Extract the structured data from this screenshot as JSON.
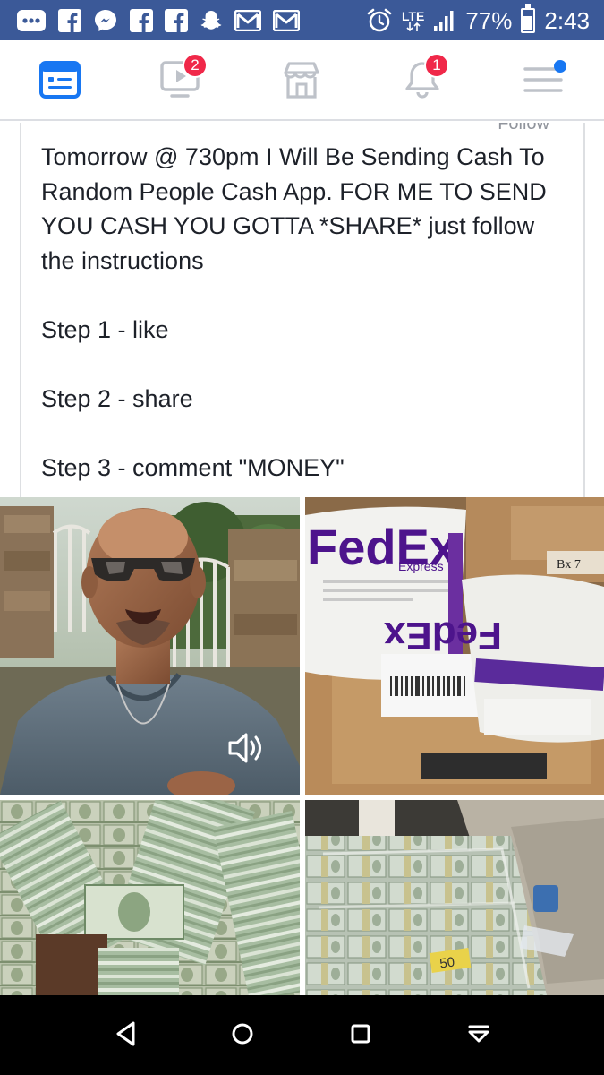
{
  "status_bar": {
    "battery_percent": "77%",
    "battery_level": 0.77,
    "network": "LTE",
    "time": "2:43",
    "background": "#3b5998",
    "left_icons": [
      "overflow-dots-icon",
      "facebook-icon",
      "messenger-icon",
      "facebook-icon",
      "facebook-icon",
      "snapchat-icon",
      "gmail-icon",
      "gmail-icon"
    ],
    "right_icons": [
      "alarm-icon",
      "lte-icon",
      "signal-icon",
      "battery-icon"
    ]
  },
  "fb_nav": {
    "items": [
      {
        "name": "news-feed",
        "icon": "news-feed-icon",
        "active": true
      },
      {
        "name": "watch",
        "icon": "video-icon",
        "badge": "2"
      },
      {
        "name": "marketplace",
        "icon": "marketplace-icon"
      },
      {
        "name": "notifications",
        "icon": "bell-icon",
        "badge": "1"
      },
      {
        "name": "menu",
        "icon": "menu-icon",
        "dot": true
      }
    ],
    "active_color": "#1877f2",
    "inactive_color": "#bec2c9",
    "badge_color": "#f02849"
  },
  "post": {
    "follow_peek": "Follow",
    "paragraphs": [
      "Tomorrow @ 730pm I Will Be Sending Cash To Random People Cash App. FOR ME TO SEND YOU CASH YOU GOTTA *SHARE* just follow the instructions",
      "Step 1 - like",
      "Step 2 - share",
      "Step 3 - comment \"MONEY\""
    ]
  },
  "photos": [
    {
      "name": "video-selfie-photo",
      "has_video": true,
      "icon": "volume-icon"
    },
    {
      "name": "fedex-packages-photo",
      "brand_text": "FedEx",
      "sub_text": "Express",
      "box_label": "Bx 7"
    },
    {
      "name": "cash-stacks-photo"
    },
    {
      "name": "cash-bundles-car-photo",
      "sticker_text": "50"
    }
  ],
  "android_nav": {
    "buttons": [
      "back-icon",
      "home-icon",
      "recents-icon",
      "notifications-pull-icon"
    ]
  }
}
